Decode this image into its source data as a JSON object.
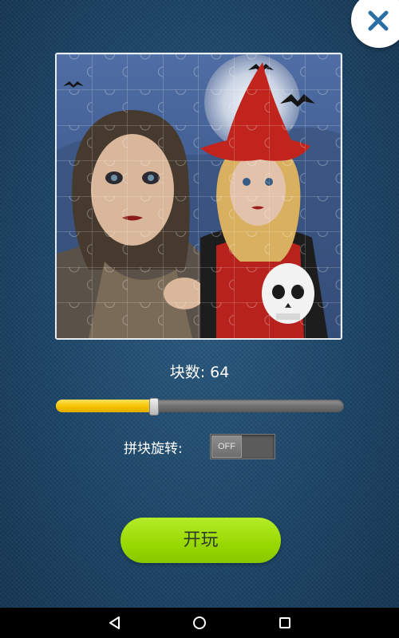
{
  "puzzle": {
    "piece_count_label": "块数: 64",
    "piece_slider_fraction": 0.34
  },
  "rotation": {
    "label": "拼块旋转:",
    "toggle_text": "OFF",
    "enabled": false
  },
  "play_button": {
    "label": "开玩"
  },
  "colors": {
    "slider_fill": "#f5c300",
    "play_button": "#98d800",
    "background": "#1c4466"
  },
  "icons": {
    "close": "close-icon",
    "back": "back-icon",
    "home": "home-icon",
    "recents": "recents-icon"
  }
}
